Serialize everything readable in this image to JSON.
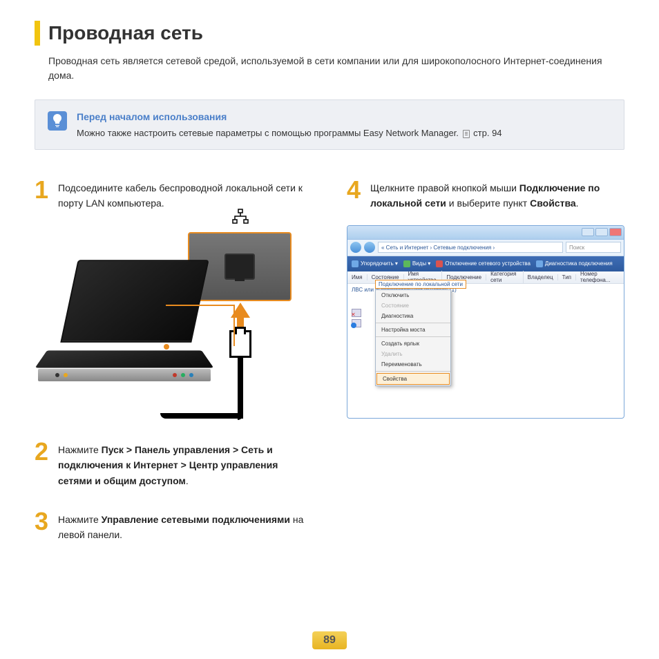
{
  "title": "Проводная сеть",
  "intro": "Проводная сеть является сетевой средой, используемой в сети компании или для широкополосного Интернет-соединения дома.",
  "tip": {
    "title": "Перед началом использования",
    "text_before": "Можно также настроить сетевые параметры с помощью программы Easy Network Manager. ",
    "page_ref": "стр. 94"
  },
  "steps": {
    "s1": {
      "num": "1",
      "text": "Подсоедините кабель беспроводной локальной сети к порту LAN компьютера."
    },
    "s2": {
      "num": "2",
      "pre": "Нажмите ",
      "bold": "Пуск > Панель управления > Сеть и подключения к Интернет > Центр управления сетями и общим доступом",
      "post": "."
    },
    "s3": {
      "num": "3",
      "pre": "Нажмите ",
      "bold": "Управление сетевыми подключениями",
      "post": " на левой панели."
    },
    "s4": {
      "num": "4",
      "pre": "Щелкните правой кнопкой мыши ",
      "bold1": "Подключение по локальной сети",
      "mid": " и выберите пункт ",
      "bold2": "Свойства",
      "post": "."
    }
  },
  "vista": {
    "breadcrumb": "« Сеть и Интернет › Сетевые подключения ›",
    "search_placeholder": "Поиск",
    "toolbar": {
      "organize": "Упорядочить ▾",
      "views": "Виды ▾",
      "disable": "Отключение сетевого устройства",
      "diagnose": "Диагностика подключения"
    },
    "columns": {
      "name": "Имя",
      "status": "Состояние",
      "device": "Имя устройства",
      "connect": "Подключение",
      "category": "Категория сети",
      "owner": "Владелец",
      "type": "Тип",
      "phone": "Номер телефона..."
    },
    "group": "ЛВС или высокоскоростной Интернет (1)",
    "connection_label": "Подключение по локальной сети",
    "menu": {
      "disable": "Отключить",
      "status": "Состояние",
      "diagnose": "Диагностика",
      "bridge": "Настройка моста",
      "shortcut": "Создать ярлык",
      "delete": "Удалить",
      "rename": "Переименовать",
      "properties": "Свойства"
    }
  },
  "page_number": "89"
}
